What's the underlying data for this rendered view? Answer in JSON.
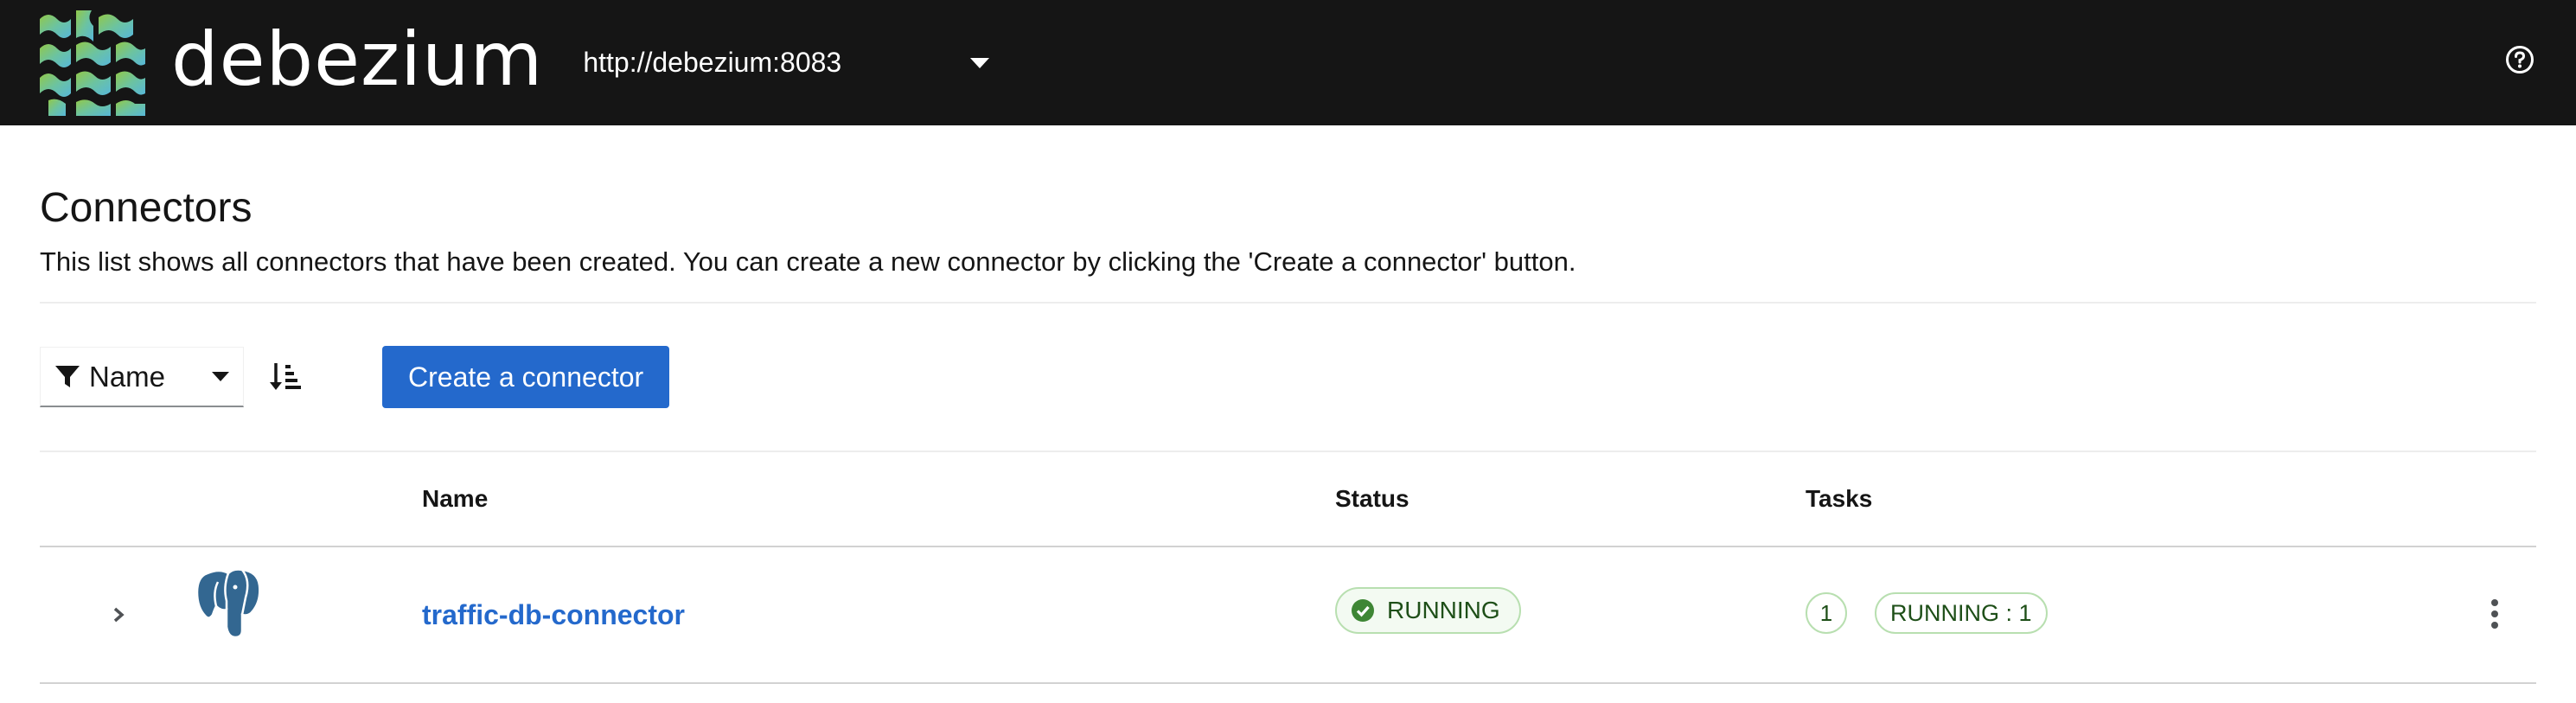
{
  "header": {
    "logo_text": "debezium",
    "server_url": "http://debezium:8083",
    "help_icon": "help-circle-icon"
  },
  "page": {
    "title": "Connectors",
    "description": "This list shows all connectors that have been created. You can create a new connector by clicking the 'Create a connector' button."
  },
  "toolbar": {
    "filter_label": "Name",
    "filter_icon": "filter-icon",
    "sort_icon": "sort-amount-down-icon",
    "create_button_label": "Create a connector"
  },
  "table": {
    "columns": [
      "Name",
      "Status",
      "Tasks"
    ],
    "rows": [
      {
        "name": "traffic-db-connector",
        "db_icon": "postgresql-elephant-icon",
        "status": "RUNNING",
        "task_count": "1",
        "task_status": "RUNNING : 1"
      }
    ]
  },
  "colors": {
    "topbar": "#151515",
    "accent": "#2469cc",
    "success": "#3e8635"
  }
}
